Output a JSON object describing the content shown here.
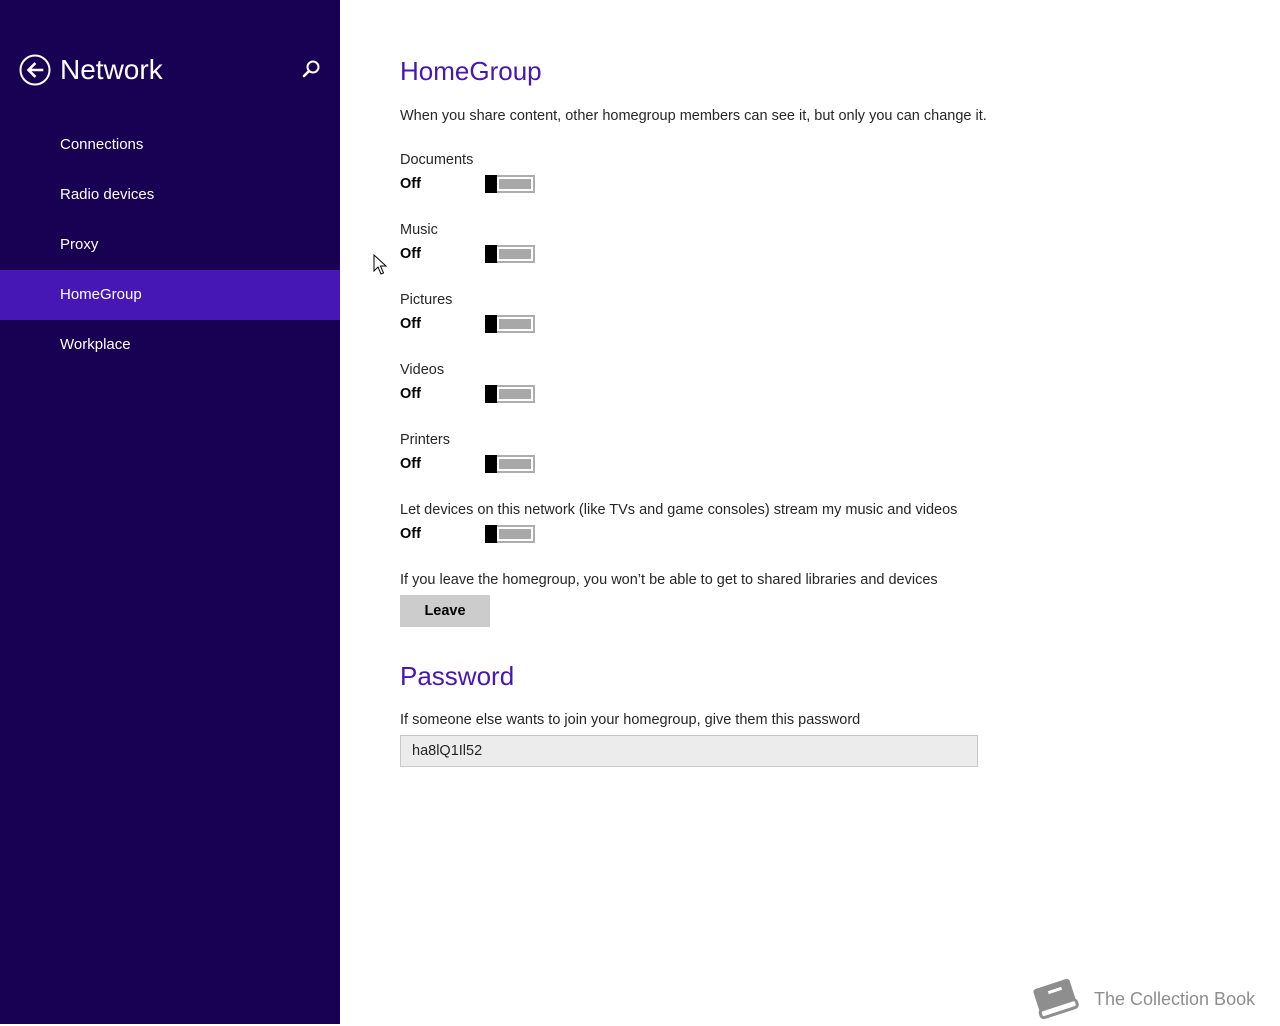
{
  "sidebar": {
    "title": "Network",
    "back_icon": "back-arrow-icon",
    "search_icon": "search-icon",
    "items": [
      {
        "label": "Connections",
        "active": false
      },
      {
        "label": "Radio devices",
        "active": false
      },
      {
        "label": "Proxy",
        "active": false
      },
      {
        "label": "HomeGroup",
        "active": true
      },
      {
        "label": "Workplace",
        "active": false
      }
    ]
  },
  "homegroup": {
    "heading": "HomeGroup",
    "description": "When you share content, other homegroup members can see it, but only you can change it.",
    "toggles": [
      {
        "label": "Documents",
        "state": "Off"
      },
      {
        "label": "Music",
        "state": "Off"
      },
      {
        "label": "Pictures",
        "state": "Off"
      },
      {
        "label": "Videos",
        "state": "Off"
      },
      {
        "label": "Printers",
        "state": "Off"
      },
      {
        "label": "Let devices on this network (like TVs and game consoles) stream my music and videos",
        "state": "Off"
      }
    ],
    "leave_description": "If you leave the homegroup, you won’t be able to get to shared libraries and devices",
    "leave_button": "Leave"
  },
  "password": {
    "heading": "Password",
    "description": "If someone else wants to join your homegroup, give them this password",
    "value": "ha8lQ1Il52"
  },
  "watermark": {
    "text": "The Collection Book",
    "icon": "book-icon"
  },
  "colors": {
    "sidebar_bg": "#180052",
    "accent": "#4617b4",
    "text": "#262626"
  }
}
